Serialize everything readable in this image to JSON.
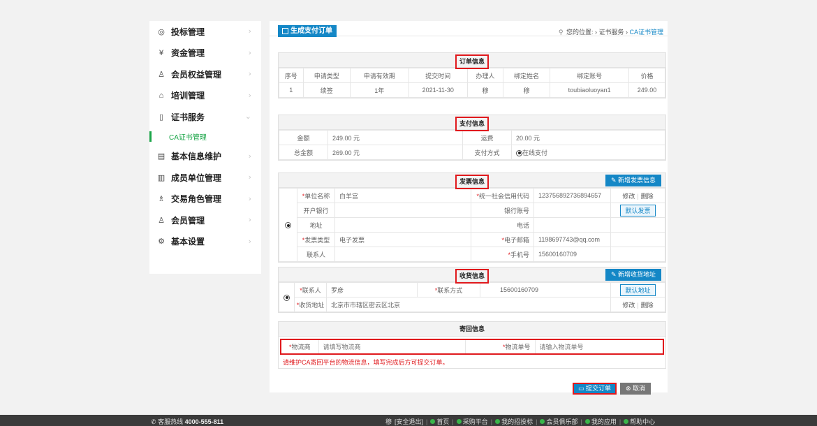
{
  "sidebar": {
    "items": [
      {
        "label": "投标管理",
        "icon": "bid-icon"
      },
      {
        "label": "资金管理",
        "icon": "yen-icon"
      },
      {
        "label": "会员权益管理",
        "icon": "member-icon"
      },
      {
        "label": "培训管理",
        "icon": "training-icon"
      },
      {
        "label": "证书服务",
        "icon": "certificate-icon"
      },
      {
        "label": "基本信息维护",
        "icon": "info-icon"
      },
      {
        "label": "成员单位管理",
        "icon": "building-icon"
      },
      {
        "label": "交易角色管理",
        "icon": "role-icon"
      },
      {
        "label": "会员管理",
        "icon": "user-icon"
      },
      {
        "label": "基本设置",
        "icon": "settings-icon"
      }
    ],
    "sub_item": "CA证书管理"
  },
  "topbar": {
    "tab_label": "生成支付订单",
    "crumb_prefix": "您的位置:",
    "crumb_path": "› 证书服务 ›",
    "crumb_current": "CA证书管理"
  },
  "order": {
    "title": "订单信息",
    "headers": [
      "序号",
      "申请类型",
      "申请有效期",
      "提交时间",
      "办理人",
      "绑定姓名",
      "绑定账号",
      "价格"
    ],
    "row": [
      "1",
      "续签",
      "1年",
      "2021-11-30",
      "穆",
      "穆",
      "toubiaoluoyan1",
      "249.00"
    ]
  },
  "payment": {
    "title": "支付信息",
    "amount_label": "金额",
    "amount_value": "249.00 元",
    "shipping_label": "运费",
    "shipping_value": "20.00 元",
    "total_label": "总金额",
    "total_value": "269.00 元",
    "method_label": "支付方式",
    "method_value": "在线支付"
  },
  "invoice": {
    "title": "发票信息",
    "add_button": "新增发票信息",
    "company_label": "单位名称",
    "company_value": "白羊宫",
    "credit_label": "统一社会信用代码",
    "credit_value": "123756892736894657",
    "edit": "修改",
    "delete": "删除",
    "bank_label": "开户银行",
    "account_label": "银行账号",
    "default_button": "默认发票",
    "address_label": "地址",
    "phone_label": "电话",
    "type_label": "发票类型",
    "type_value": "电子发票",
    "email_label": "电子邮箱",
    "email_value": "1198697743@qq.com",
    "contact_label": "联系人",
    "mobile_label": "手机号",
    "mobile_value": "15600160709"
  },
  "receipt": {
    "title": "收货信息",
    "add_button": "新增收货地址",
    "contact_label": "联系人",
    "contact_value": "罗彦",
    "method_label": "联系方式",
    "method_value": "15600160709",
    "default_button": "默认地址",
    "address_label": "收货地址",
    "address_value": "北京市市辖区密云区北京",
    "edit": "修改",
    "delete": "删除"
  },
  "return": {
    "title": "寄回信息",
    "carrier_label": "物流商",
    "carrier_placeholder": "请填写物流商",
    "tracking_label": "物流单号",
    "tracking_placeholder": "请输入物流单号",
    "notice": "请维护CA寄回平台的物流信息，填写完成后方可提交订单。"
  },
  "actions": {
    "submit": "提交订单",
    "cancel": "取消"
  },
  "footer": {
    "hotline_label": "客服热线",
    "hotline_number": "4000-555-811",
    "user": "穆",
    "logout": "[安全退出]",
    "links": [
      "首页",
      "采购平台",
      "我的招投标",
      "会员俱乐部",
      "我的应用",
      "帮助中心"
    ]
  },
  "colors": {
    "accent": "#1487c6",
    "green": "#1aa548",
    "red": "#e0191d"
  }
}
